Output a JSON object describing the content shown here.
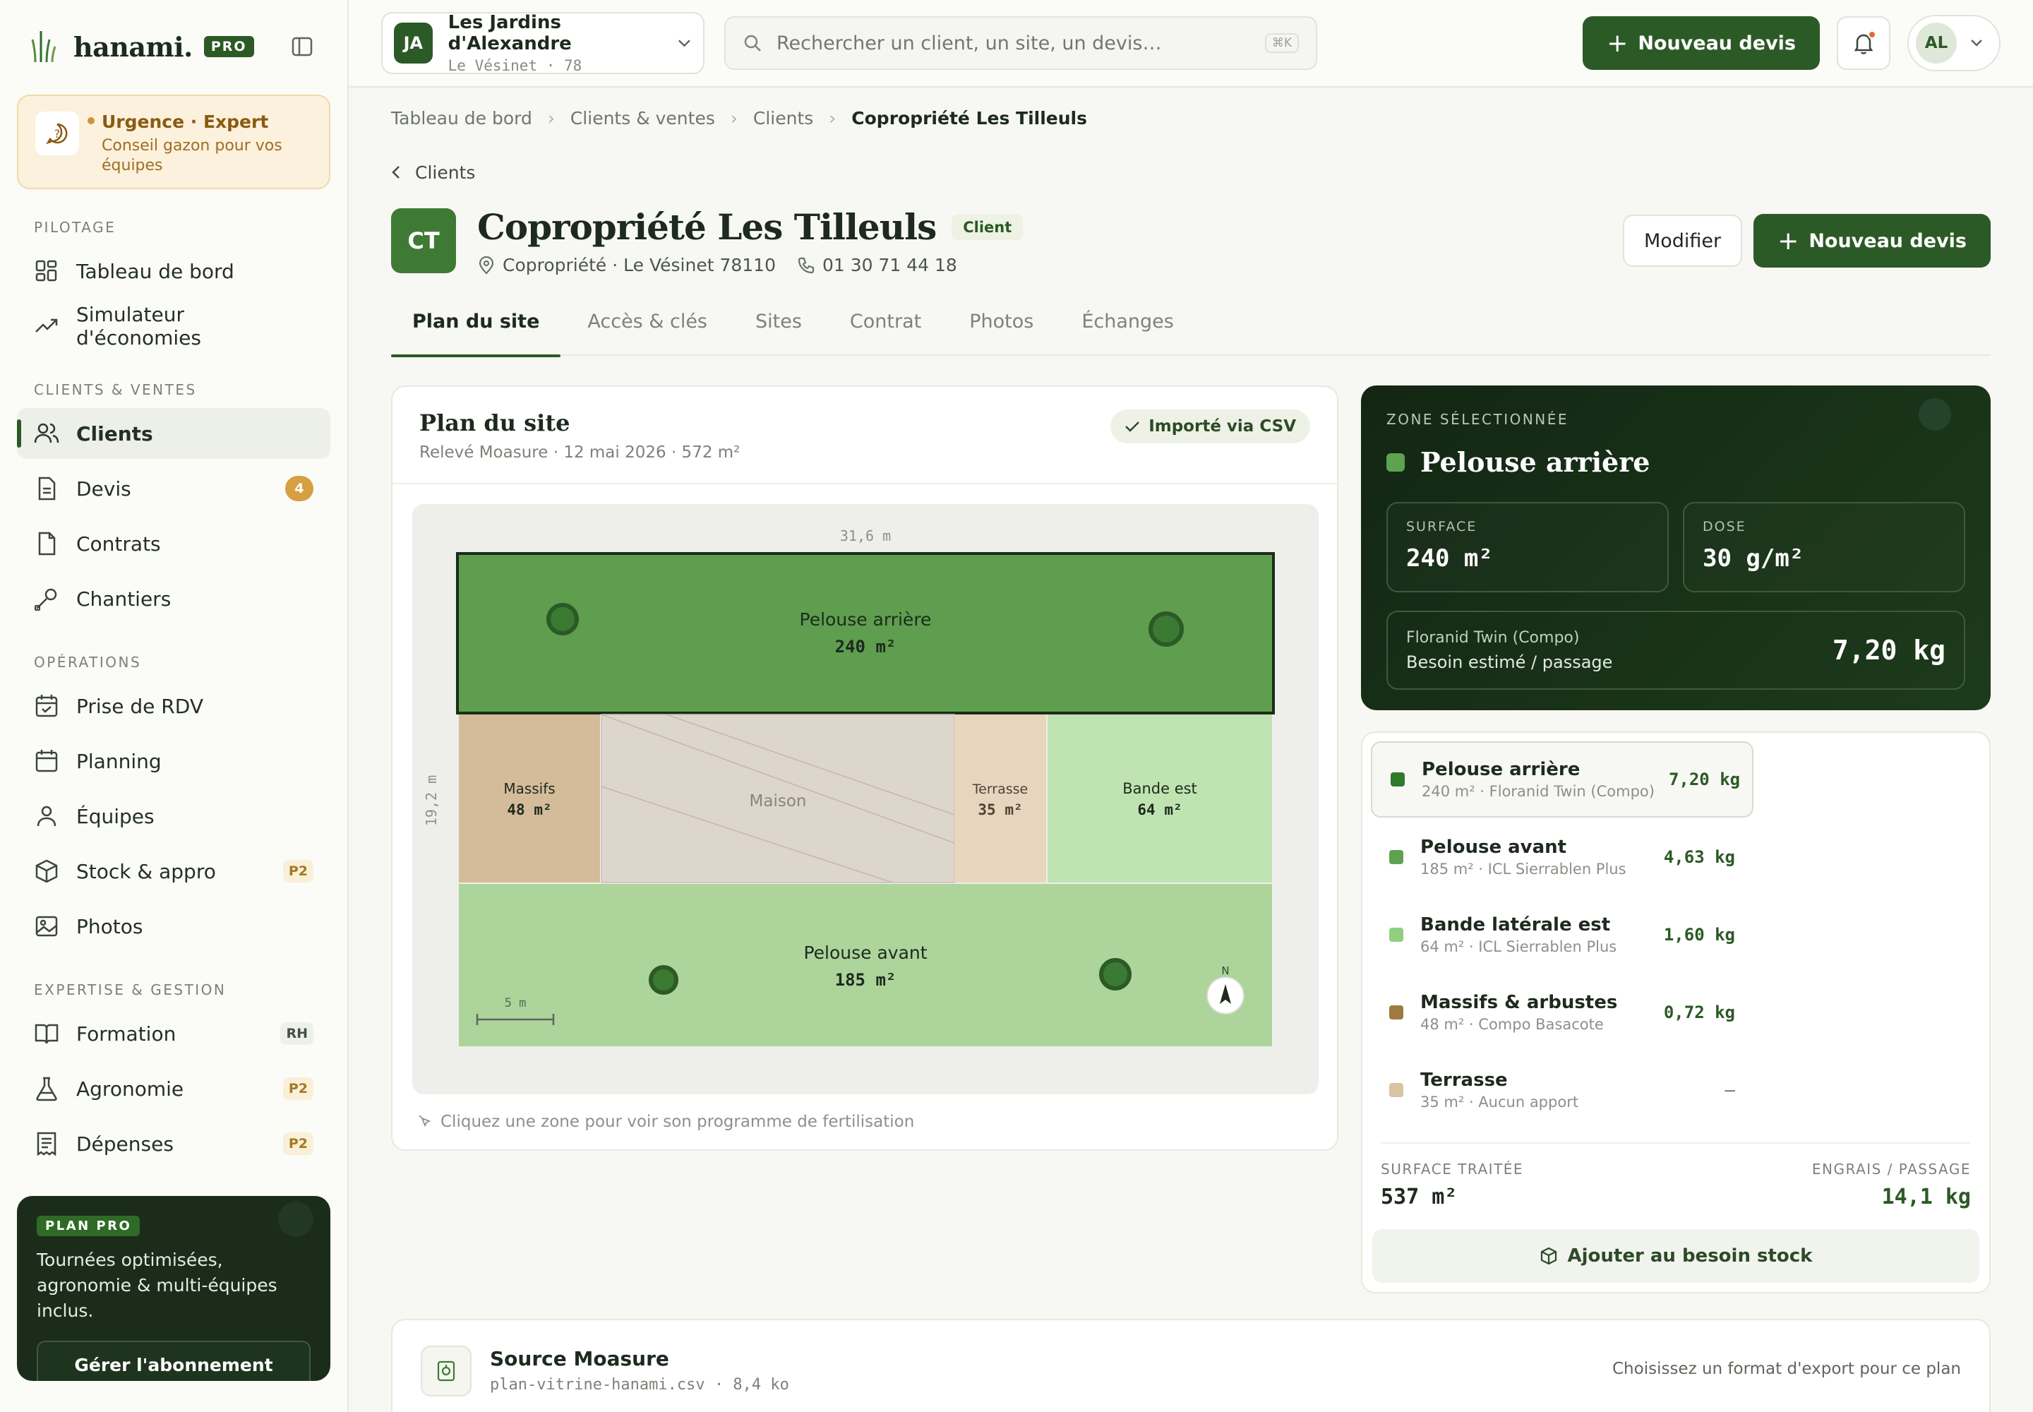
{
  "brand": {
    "name": "hanami.",
    "badge": "PRO"
  },
  "urgence": {
    "title": "Urgence · Expert",
    "subtitle": "Conseil gazon pour vos équipes"
  },
  "nav": {
    "sections": {
      "pilotage": "PILOTAGE",
      "clients": "CLIENTS & VENTES",
      "operations": "OPÉRATIONS",
      "expertise": "EXPERTISE & GESTION"
    },
    "items": {
      "dashboard": "Tableau de bord",
      "simulator": "Simulateur d'économies",
      "clients": "Clients",
      "devis": "Devis",
      "devis_badge": "4",
      "contrats": "Contrats",
      "chantiers": "Chantiers",
      "rdv": "Prise de RDV",
      "planning": "Planning",
      "equipes": "Équipes",
      "stock": "Stock & appro",
      "stock_badge": "P2",
      "photos": "Photos",
      "formation": "Formation",
      "formation_badge": "RH",
      "agronomie": "Agronomie",
      "agronomie_badge": "P2",
      "depenses": "Dépenses",
      "depenses_badge": "P2"
    }
  },
  "plan_pro": {
    "badge": "PLAN PRO",
    "text": "Tournées optimisées, agronomie & multi-équipes inclus.",
    "button": "Gérer l'abonnement"
  },
  "topbar": {
    "org_initials": "JA",
    "org_name": "Les Jardins d'Alexandre",
    "org_sub": "Le Vésinet · 78",
    "search_placeholder": "Rechercher un client, un site, un devis…",
    "search_kbd": "⌘K",
    "new_quote": "Nouveau devis",
    "user_initials": "AL"
  },
  "breadcrumb": [
    "Tableau de bord",
    "Clients & ventes",
    "Clients",
    "Copropriété Les Tilleuls"
  ],
  "back_label": "Clients",
  "client": {
    "initials": "CT",
    "name": "Copropriété Les Tilleuls",
    "tag": "Client",
    "location": "Copropriété · Le Vésinet 78110",
    "phone": "01 30 71 44 18",
    "edit": "Modifier",
    "new_quote": "Nouveau devis"
  },
  "tabs": [
    "Plan du site",
    "Accès & clés",
    "Sites",
    "Contrat",
    "Photos",
    "Échanges"
  ],
  "plan": {
    "title": "Plan du site",
    "subtitle": "Relevé Moasure · 12 mai 2026 · 572 m²",
    "import_pill": "Importé via CSV",
    "width_label": "31,6 m",
    "height_label": "19,2 m",
    "scale_label": "5 m",
    "north": "N",
    "hint": "Cliquez une zone pour voir son programme de fertilisation",
    "zones": {
      "back": {
        "name": "Pelouse arrière",
        "area": "240 m²"
      },
      "massifs": {
        "name": "Massifs",
        "area": "48 m²"
      },
      "maison": {
        "name": "Maison"
      },
      "terrasse": {
        "name": "Terrasse",
        "area": "35 m²"
      },
      "bande": {
        "name": "Bande est",
        "area": "64 m²"
      },
      "front": {
        "name": "Pelouse avant",
        "area": "185 m²"
      }
    }
  },
  "selected_zone": {
    "label": "ZONE SÉLECTIONNÉE",
    "name": "Pelouse arrière",
    "surface_label": "SURFACE",
    "surface": "240 m²",
    "dose_label": "DOSE",
    "dose": "30 g/m²",
    "product": "Floranid Twin (Compo)",
    "need_label": "Besoin estimé / passage",
    "need": "7,20 kg"
  },
  "zone_list": [
    {
      "name": "Pelouse arrière",
      "sub": "240 m² · Floranid Twin (Compo)",
      "value": "7,20 kg",
      "color": "#2f7a2c"
    },
    {
      "name": "Pelouse avant",
      "sub": "185 m² · ICL Sierrablen Plus",
      "value": "4,63 kg",
      "color": "#5ea24f"
    },
    {
      "name": "Bande latérale est",
      "sub": "64 m² · ICL Sierrablen Plus",
      "value": "1,60 kg",
      "color": "#8fcf7d"
    },
    {
      "name": "Massifs & arbustes",
      "sub": "48 m² · Compo Basacote",
      "value": "0,72 kg",
      "color": "#a07a3c"
    },
    {
      "name": "Terrasse",
      "sub": "35 m² · Aucun apport",
      "value": "—",
      "color": "#d8c3a3"
    }
  ],
  "totals": {
    "surface_label": "SURFACE TRAITÉE",
    "surface": "537 m²",
    "engrais_label": "ENGRAIS / PASSAGE",
    "engrais": "14,1 kg"
  },
  "stock_button": "Ajouter au besoin stock",
  "source": {
    "title": "Source Moasure",
    "file": "plan-vitrine-hanami.csv · 8,4 ko",
    "right": "Choisissez un format d'export pour ce plan"
  }
}
